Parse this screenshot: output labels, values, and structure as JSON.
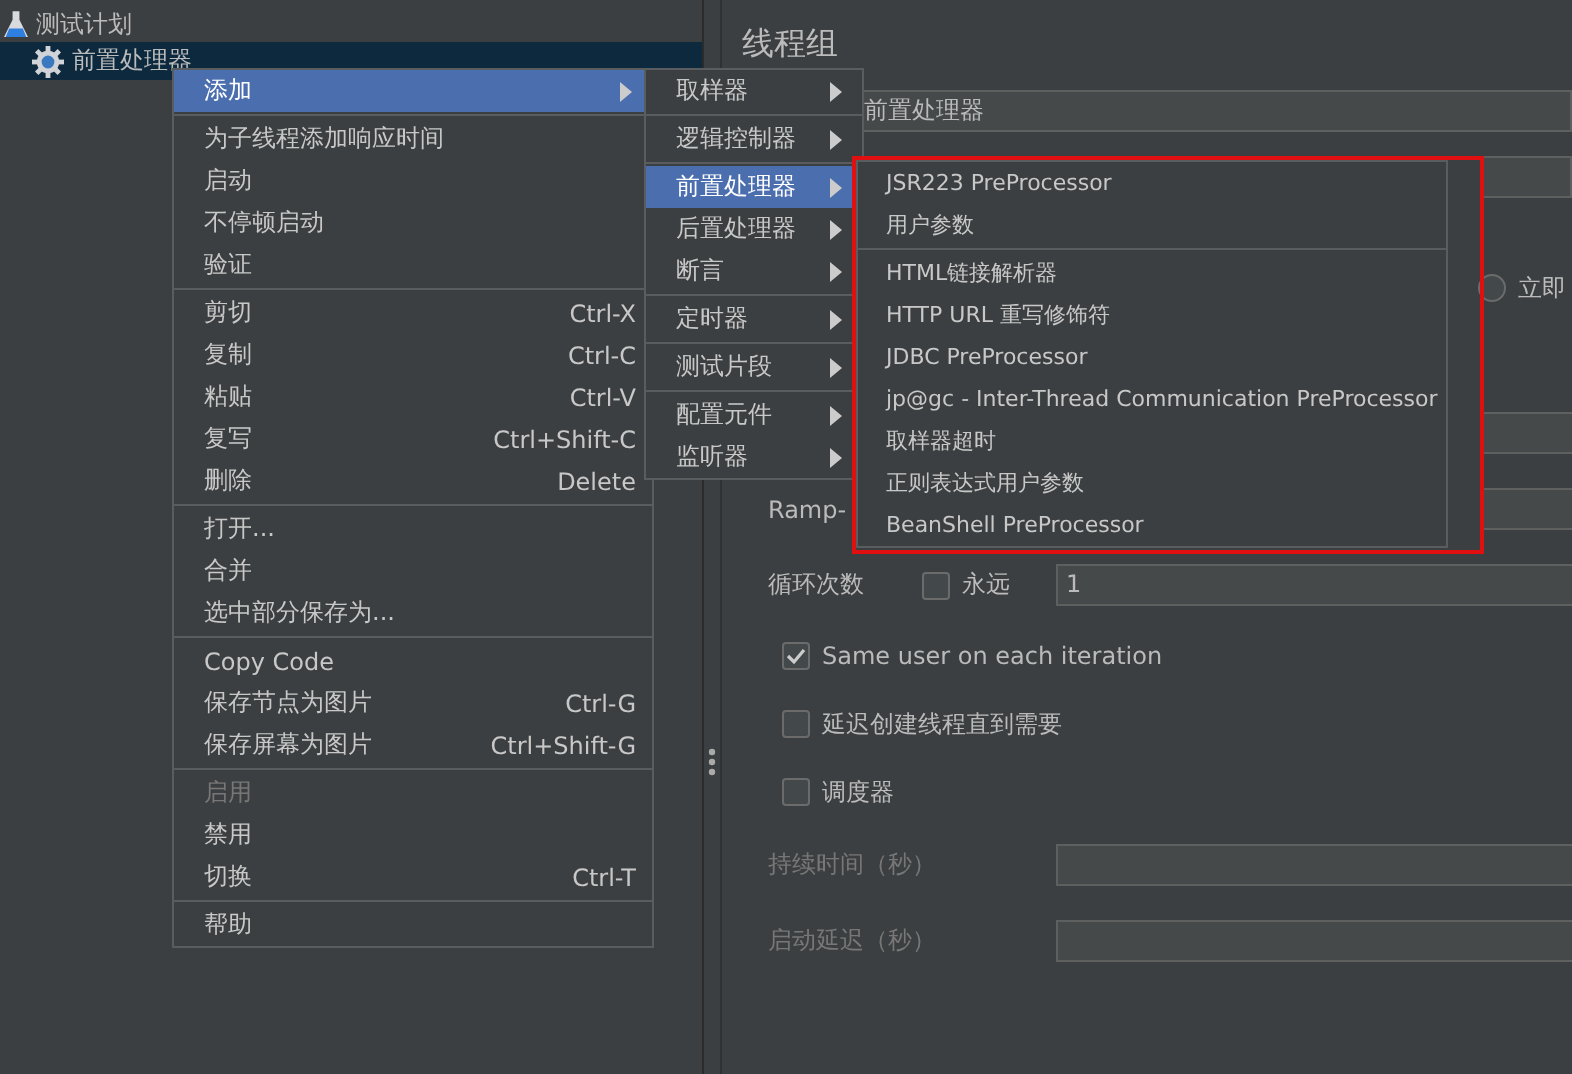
{
  "tree": [
    {
      "label": "测试计划",
      "selected": false,
      "children": [
        {
          "label": "前置处理器",
          "selected": true
        }
      ]
    }
  ],
  "panel": {
    "title": "线程组",
    "name_value": "前置处理器",
    "radio_label": "立即",
    "radio_selected": false,
    "ramp_label": "Ramp-",
    "loop_label": "循环次数",
    "forever_label": "永远",
    "forever_checked": false,
    "loop_value": "1",
    "checks": [
      {
        "label": "Same user on each iteration",
        "checked": true
      },
      {
        "label": "延迟创建线程直到需要",
        "checked": false
      },
      {
        "label": "调度器",
        "checked": false
      }
    ],
    "disabled_fields": [
      {
        "label": "持续时间（秒）"
      },
      {
        "label": "启动延迟（秒）"
      }
    ]
  },
  "context_menu": [
    {
      "kind": "item",
      "label": "添加",
      "submenu": true,
      "selected": true,
      "disabled": false
    },
    {
      "kind": "separator"
    },
    {
      "kind": "item",
      "label": "为子线程添加响应时间",
      "submenu": false,
      "selected": false,
      "disabled": false
    },
    {
      "kind": "item",
      "label": "启动",
      "submenu": false,
      "selected": false,
      "disabled": false
    },
    {
      "kind": "item",
      "label": "不停顿启动",
      "submenu": false,
      "selected": false,
      "disabled": false
    },
    {
      "kind": "item",
      "label": "验证",
      "submenu": false,
      "selected": false,
      "disabled": false
    },
    {
      "kind": "separator"
    },
    {
      "kind": "item",
      "label": "剪切",
      "shortcut": "Ctrl-X",
      "submenu": false,
      "selected": false,
      "disabled": false
    },
    {
      "kind": "item",
      "label": "复制",
      "shortcut": "Ctrl-C",
      "submenu": false,
      "selected": false,
      "disabled": false
    },
    {
      "kind": "item",
      "label": "粘贴",
      "shortcut": "Ctrl-V",
      "submenu": false,
      "selected": false,
      "disabled": false
    },
    {
      "kind": "item",
      "label": "复写",
      "shortcut": "Ctrl+Shift-C",
      "submenu": false,
      "selected": false,
      "disabled": false
    },
    {
      "kind": "item",
      "label": "删除",
      "shortcut": "Delete",
      "submenu": false,
      "selected": false,
      "disabled": false
    },
    {
      "kind": "separator"
    },
    {
      "kind": "item",
      "label": "打开...",
      "submenu": false,
      "selected": false,
      "disabled": false
    },
    {
      "kind": "item",
      "label": "合并",
      "submenu": false,
      "selected": false,
      "disabled": false
    },
    {
      "kind": "item",
      "label": "选中部分保存为...",
      "submenu": false,
      "selected": false,
      "disabled": false
    },
    {
      "kind": "separator"
    },
    {
      "kind": "item",
      "label": "Copy Code",
      "submenu": false,
      "selected": false,
      "disabled": false
    },
    {
      "kind": "item",
      "label": "保存节点为图片",
      "shortcut": "Ctrl-G",
      "submenu": false,
      "selected": false,
      "disabled": false
    },
    {
      "kind": "item",
      "label": "保存屏幕为图片",
      "shortcut": "Ctrl+Shift-G",
      "submenu": false,
      "selected": false,
      "disabled": false
    },
    {
      "kind": "separator"
    },
    {
      "kind": "item",
      "label": "启用",
      "submenu": false,
      "selected": false,
      "disabled": true
    },
    {
      "kind": "item",
      "label": "禁用",
      "submenu": false,
      "selected": false,
      "disabled": false
    },
    {
      "kind": "item",
      "label": "切换",
      "shortcut": "Ctrl-T",
      "submenu": false,
      "selected": false,
      "disabled": false
    },
    {
      "kind": "separator"
    },
    {
      "kind": "item",
      "label": "帮助",
      "submenu": false,
      "selected": false,
      "disabled": false
    }
  ],
  "add_submenu": [
    {
      "kind": "item",
      "label": "取样器",
      "submenu": true,
      "selected": false
    },
    {
      "kind": "separator"
    },
    {
      "kind": "item",
      "label": "逻辑控制器",
      "submenu": true,
      "selected": false
    },
    {
      "kind": "separator"
    },
    {
      "kind": "item",
      "label": "前置处理器",
      "submenu": true,
      "selected": true
    },
    {
      "kind": "item",
      "label": "后置处理器",
      "submenu": true,
      "selected": false
    },
    {
      "kind": "item",
      "label": "断言",
      "submenu": true,
      "selected": false
    },
    {
      "kind": "separator"
    },
    {
      "kind": "item",
      "label": "定时器",
      "submenu": true,
      "selected": false
    },
    {
      "kind": "separator"
    },
    {
      "kind": "item",
      "label": "测试片段",
      "submenu": true,
      "selected": false
    },
    {
      "kind": "separator"
    },
    {
      "kind": "item",
      "label": "配置元件",
      "submenu": true,
      "selected": false
    },
    {
      "kind": "item",
      "label": "监听器",
      "submenu": true,
      "selected": false
    }
  ],
  "preprocessor_submenu": [
    {
      "kind": "item",
      "label": "JSR223 PreProcessor",
      "selected": false
    },
    {
      "kind": "item",
      "label": "用户参数",
      "selected": false
    },
    {
      "kind": "separator"
    },
    {
      "kind": "item",
      "label": "HTML链接解析器",
      "selected": false
    },
    {
      "kind": "item",
      "label": "HTTP URL 重写修饰符",
      "selected": false
    },
    {
      "kind": "item",
      "label": "JDBC PreProcessor",
      "selected": false
    },
    {
      "kind": "item",
      "label": "jp@gc - Inter-Thread Communication PreProcessor",
      "selected": false
    },
    {
      "kind": "item",
      "label": "取样器超时",
      "selected": false
    },
    {
      "kind": "item",
      "label": "正则表达式用户参数",
      "selected": false
    },
    {
      "kind": "item",
      "label": "BeanShell PreProcessor",
      "selected": false
    }
  ]
}
